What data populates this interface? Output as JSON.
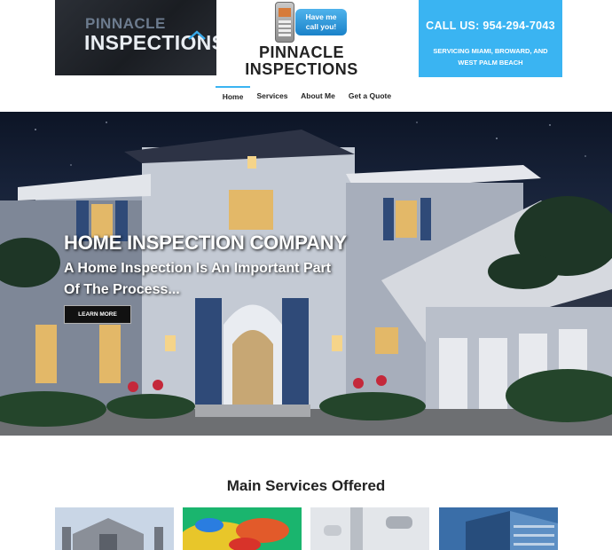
{
  "header": {
    "logo": {
      "line1": "PINNACLE",
      "line2": "INSPECTIONS"
    },
    "call_bubble": {
      "line1": "Have me",
      "line2": "call you!"
    },
    "brand": {
      "line1": "PINNACLE",
      "line2": "INSPECTIONS"
    },
    "call_box": {
      "phone": "CALL US: 954-294-7043",
      "service_area": "SERVICING MIAMI, BROWARD, AND WEST PALM BEACH"
    }
  },
  "nav": {
    "items": [
      {
        "label": "Home",
        "active": true
      },
      {
        "label": "Services",
        "active": false
      },
      {
        "label": "About Me",
        "active": false
      },
      {
        "label": "Get a Quote",
        "active": false
      }
    ]
  },
  "hero": {
    "title": "HOME INSPECTION COMPANY",
    "subtitle": "A Home Inspection Is An Important Part Of The Process...",
    "button": "LEARN MORE"
  },
  "services": {
    "heading": "Main Services Offered",
    "thumbnails": [
      {
        "icon": "house-photo"
      },
      {
        "icon": "thermal-image"
      },
      {
        "icon": "plumbing-pipes"
      },
      {
        "icon": "commercial-building"
      }
    ]
  },
  "colors": {
    "accent": "#3ab4f2",
    "dark": "#222222"
  }
}
